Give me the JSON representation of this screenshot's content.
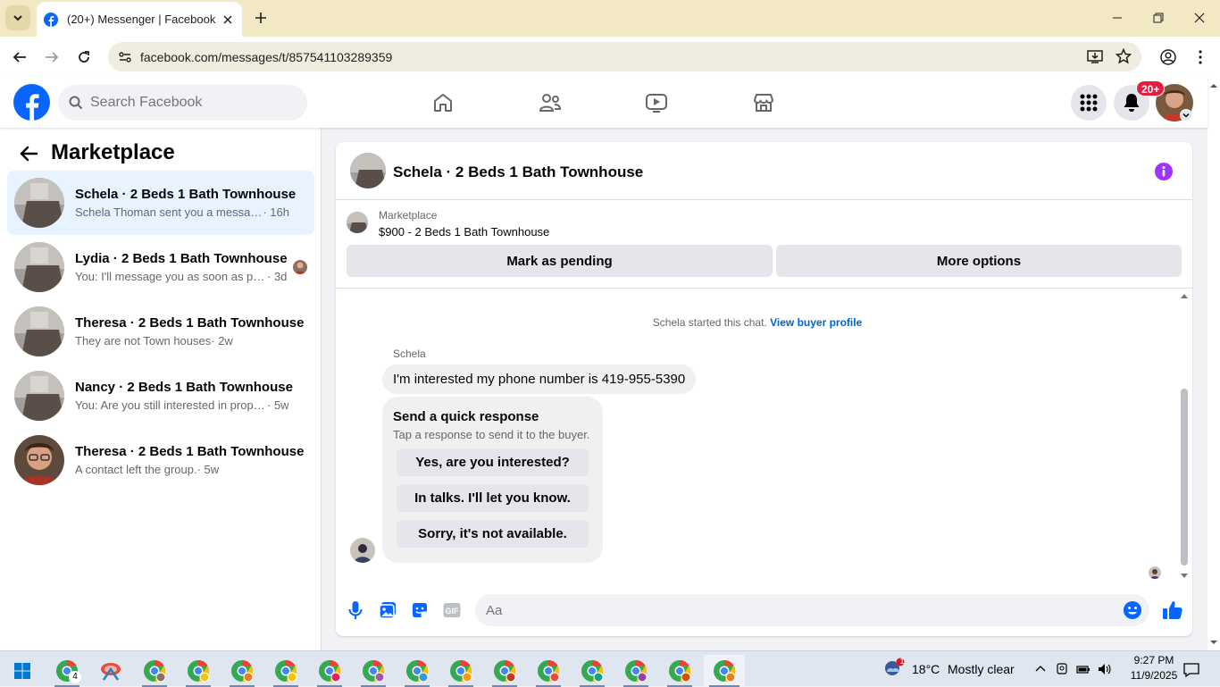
{
  "browser": {
    "tab_title": "(20+) Messenger | Facebook",
    "url": "facebook.com/messages/t/857541103289359"
  },
  "facebook": {
    "search_placeholder": "Search Facebook",
    "notifications_badge": "20+"
  },
  "marketplace": {
    "title": "Marketplace",
    "conversations": [
      {
        "name": "Schela · 2 Beds 1 Bath Townhouse",
        "snippet": "Schela Thoman sent you a message ...",
        "time": " · 16h",
        "active": true
      },
      {
        "name": "Lydia · 2 Beds 1 Bath Townhouse",
        "snippet": "You: I'll message you as soon as po...",
        "time": " · 3d",
        "active": false
      },
      {
        "name": "Theresa · 2 Beds 1 Bath Townhouse",
        "snippet": "They are not Town houses",
        "time": " · 2w",
        "active": false
      },
      {
        "name": "Nancy · 2 Beds 1 Bath Townhouse",
        "snippet": "You: Are you still interested in proper...",
        "time": " · 5w",
        "active": false
      },
      {
        "name": "Theresa · 2 Beds 1 Bath Townhouse",
        "snippet": "A contact left the group.",
        "time": " · 5w",
        "active": false
      }
    ]
  },
  "chat": {
    "title": "Schela · 2 Beds 1 Bath Townhouse",
    "listing_label": "Marketplace",
    "listing_price": "$900 - 2 Beds 1 Bath Townhouse",
    "mark_pending": "Mark as pending",
    "more_options": "More options",
    "started_text": "Schela started this chat.",
    "buyer_profile_link": "View buyer profile",
    "sender_name": "Schela",
    "message": "I'm interested my phone number is 419-955-5390",
    "quick_response": {
      "title": "Send a quick response",
      "subtitle": "Tap a response to send it to the buyer.",
      "options": [
        "Yes, are you interested?",
        "In talks. I'll let you know.",
        "Sorry, it's not available."
      ]
    },
    "composer_placeholder": "Aa"
  },
  "taskbar": {
    "weather_temp": "18°C",
    "weather_desc": "Mostly clear",
    "weather_badge": "1",
    "time": "9:27 PM",
    "date": "11/9/2025",
    "first_app_badge": "4"
  },
  "colors": {
    "fb_blue": "#0866ff",
    "active_conv": "#e7f3ff",
    "notif_red": "#e41e3f",
    "info_purple": "#a033ff"
  }
}
